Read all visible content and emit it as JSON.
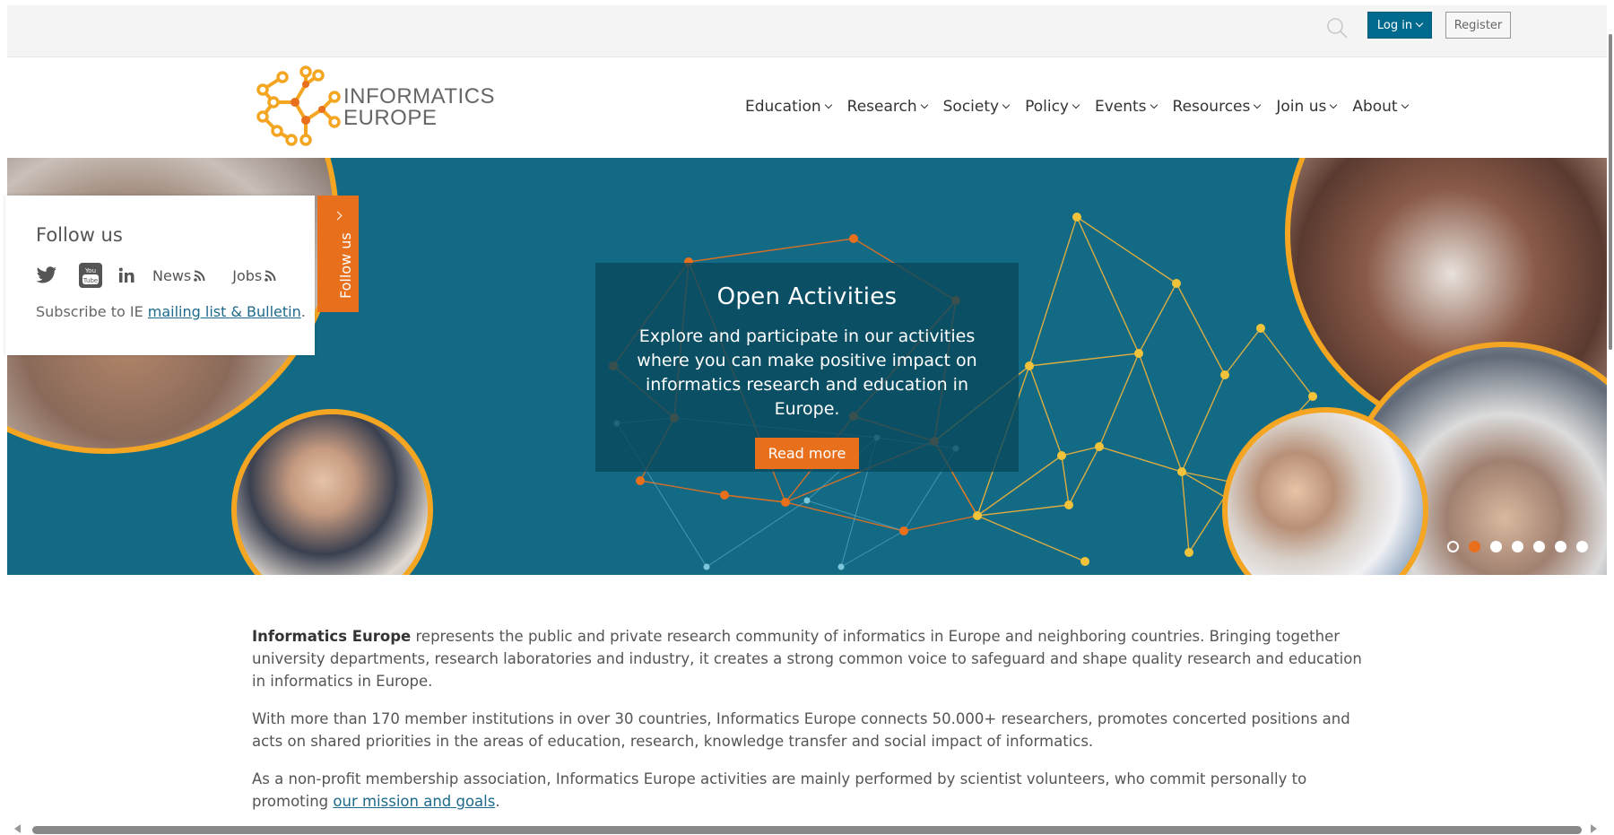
{
  "topbar": {
    "login_label": "Log in",
    "register_label": "Register"
  },
  "brand": {
    "line1": "INFORMATICS",
    "line2": "EUROPE",
    "orange": "#f4a623",
    "teal": "#006a8e"
  },
  "nav": {
    "items": [
      {
        "label": "Education"
      },
      {
        "label": "Research"
      },
      {
        "label": "Society"
      },
      {
        "label": "Policy"
      },
      {
        "label": "Events"
      },
      {
        "label": "Resources"
      },
      {
        "label": "Join us"
      },
      {
        "label": "About"
      }
    ]
  },
  "follow": {
    "title": "Follow us",
    "news_label": "News",
    "jobs_label": "Jobs",
    "subscribe_prefix": "Subscribe to IE ",
    "subscribe_link": "mailing list & Bulletin",
    "subscribe_suffix": ".",
    "tab_label": "Follow us"
  },
  "hero": {
    "title": "Open Activities",
    "body": "Explore and participate in our activities where you can make positive impact on informatics research and education in Europe.",
    "button_label": "Read more",
    "slide_count": 7,
    "active_slide": 2
  },
  "intro": {
    "p1_strong": "Informatics Europe",
    "p1_rest": " represents the public and private research community of informatics in Europe and neighboring countries. Bringing together university departments, research laboratories and industry, it creates a strong common voice to safeguard and shape quality research and education in informatics in Europe.",
    "p2": "With more than 170 member institutions in over 30 countries, Informatics Europe connects 50.000+ researchers, promotes concerted positions and acts on shared priorities in the areas of education, research, knowledge transfer and social impact of informatics.",
    "p3_text": "As a non-profit membership association, Informatics Europe activities are mainly performed by scientist volunteers, who commit personally to promoting ",
    "p3_link": "our mission and goals",
    "p3_end": "."
  }
}
